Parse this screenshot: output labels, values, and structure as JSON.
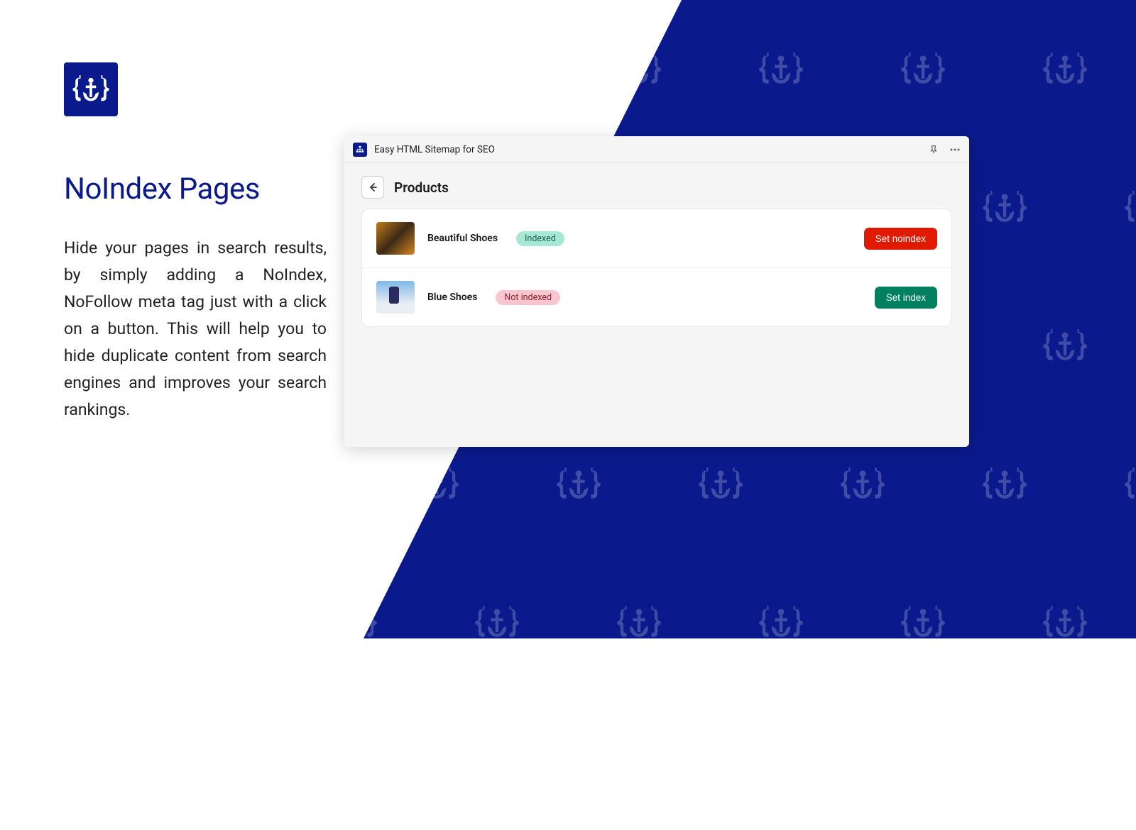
{
  "brand": {
    "name": "anchor-brand"
  },
  "marketing": {
    "title": "NoIndex Pages",
    "description": "Hide your pages in search results, by simply adding a NoIndex, NoFollow meta tag just with a click on a button. This will help you to hide duplicate content from search engines and improves your search rankings."
  },
  "app": {
    "header_title": "Easy HTML Sitemap for SEO",
    "page_title": "Products",
    "products": [
      {
        "name": "Beautiful Shoes",
        "status_label": "Indexed",
        "status": "indexed",
        "action_label": "Set noindex"
      },
      {
        "name": "Blue Shoes",
        "status_label": "Not indexed",
        "status": "notindexed",
        "action_label": "Set index"
      }
    ]
  },
  "colors": {
    "brand_blue": "#0a1a8c",
    "btn_danger": "#e11900",
    "btn_success": "#008060"
  }
}
